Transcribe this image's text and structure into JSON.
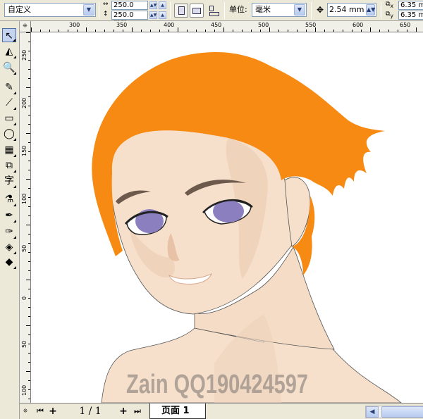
{
  "propbar": {
    "paper_preset": "自定义",
    "width_value": "250.0 mm",
    "height_value": "250.0 mm",
    "units_label": "单位:",
    "units_value": "毫米",
    "nudge_value": "2.54 mm",
    "dup_x_value": "6.35 m",
    "dup_y_value": "6.35 m",
    "dup_x_label": "x",
    "dup_y_label": "y"
  },
  "ruler": {
    "corner_glyph": "⁜",
    "h_ticks": [
      "300",
      "350",
      "400",
      "450",
      "500",
      "550",
      "600",
      "650"
    ],
    "v_ticks": [
      "250",
      "200",
      "150",
      "100",
      "50",
      "0",
      "50",
      "100"
    ]
  },
  "toolbox": {
    "tools": [
      {
        "name": "pick-tool-icon",
        "glyph": "↖"
      },
      {
        "name": "shape-tool-icon",
        "glyph": "◭"
      },
      {
        "name": "zoom-tool-icon",
        "glyph": "🔍"
      },
      {
        "name": "freehand-tool-icon",
        "glyph": "✎"
      },
      {
        "name": "smart-draw-tool-icon",
        "glyph": "⟋"
      },
      {
        "name": "rectangle-tool-icon",
        "glyph": "▭"
      },
      {
        "name": "ellipse-tool-icon",
        "glyph": "◯"
      },
      {
        "name": "graph-paper-tool-icon",
        "glyph": "▦"
      },
      {
        "name": "basic-shapes-tool-icon",
        "glyph": "⧉"
      },
      {
        "name": "text-tool-icon",
        "glyph": "字"
      },
      {
        "name": "interactive-blend-tool-icon",
        "glyph": "⚗"
      },
      {
        "name": "eyedropper-tool-icon",
        "glyph": "✒"
      },
      {
        "name": "outline-tool-icon",
        "glyph": "✑"
      },
      {
        "name": "fill-tool-icon",
        "glyph": "◈"
      },
      {
        "name": "interactive-fill-tool-icon",
        "glyph": "◆"
      }
    ]
  },
  "watermark": "Zain QQ190424597",
  "bottombar": {
    "first_glyph": "⏮",
    "add_glyph": "+",
    "page_count": "1 / 1",
    "add2_glyph": "+",
    "last_glyph": "⏭",
    "page_tab": "页面 1",
    "scroll_left_glyph": "◀"
  },
  "colors": {
    "hair": "#f68a12",
    "skin": "#f6e0cc",
    "skin_shadow": "#efd0b6",
    "eye": "#8c7fc0",
    "brow": "#6e5a4c"
  }
}
